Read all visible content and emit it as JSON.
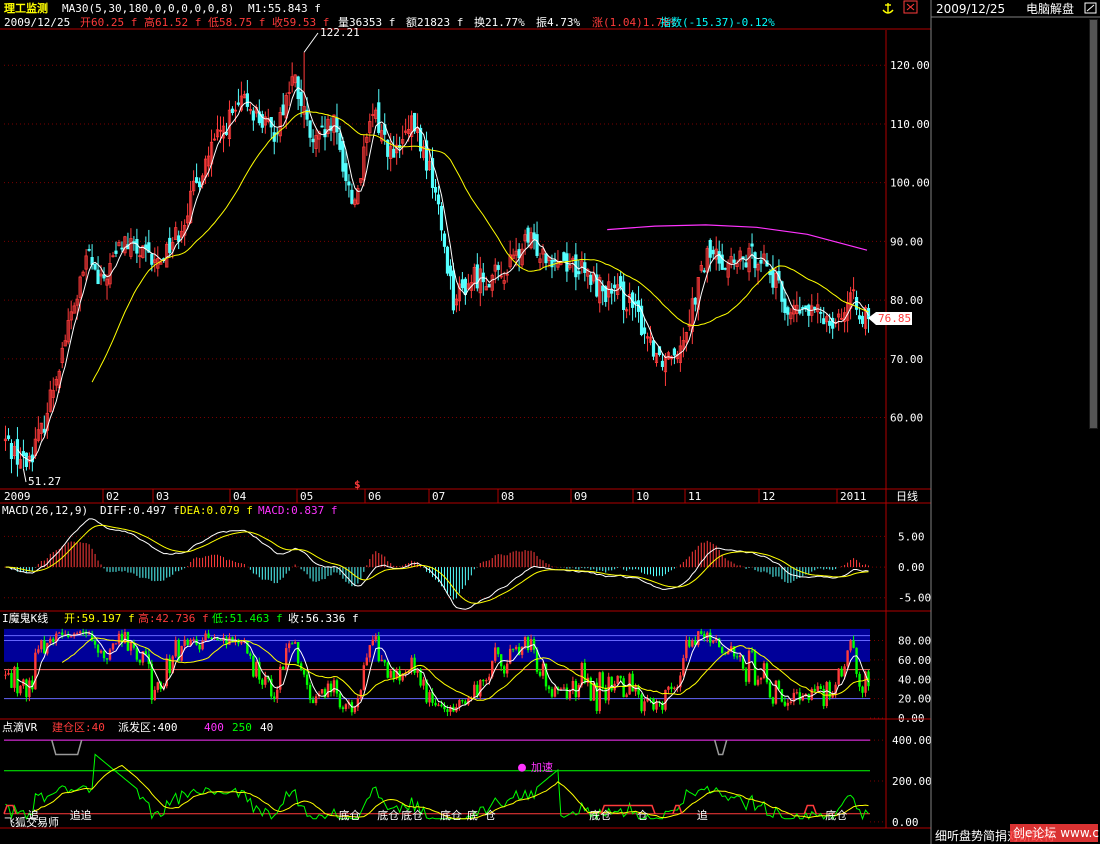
{
  "colors": {
    "bg": "#000000",
    "up": "#ff3b3b",
    "down": "#54ffff",
    "grid": "#7a0000",
    "border": "#b00000",
    "white": "#ffffff",
    "yellow": "#ffff00",
    "magenta": "#ff33ff",
    "cyan": "#00ffff",
    "green": "#00ff00",
    "blueband": "#000099",
    "gray": "#999999",
    "price_tag": "#ff3b3b"
  },
  "header": {
    "name": "理工监测",
    "ma_label": "MA30(5,30,180,0,0,0,0,0,8)",
    "m1": "M1:55.843 f",
    "date": "2009/12/25",
    "open": "开60.25 f",
    "high": "高61.52 f",
    "low": "低58.75 f",
    "close": "收59.53 f",
    "vol": "量36353 f",
    "amount": "额21823 f",
    "turnover": "换21.77%",
    "amplitude": "振4.73%",
    "change": "涨(1.04)1.78%",
    "index": "指数(-15.37)-0.12%"
  },
  "sidebar": {
    "date": "2009/12/25",
    "title": "电脑解盘"
  },
  "bottom_right_text": "细听盘势简捐对研跌将",
  "watermark": "创e论坛 www.cnci.com",
  "anchor_icon": "anchor-icon",
  "chart_data": [
    {
      "type": "candlestick",
      "panel": "price",
      "ylim": [
        48,
        126
      ],
      "yticks": [
        60,
        70,
        80,
        90,
        100,
        110,
        120
      ],
      "ytick_labels": [
        "60.00",
        "70.00",
        "80.00",
        "90.00",
        "100.00",
        "110.00",
        "120.00"
      ],
      "annotations": {
        "max_label": "122.21",
        "max_value": 122.21,
        "min_label": "51.27",
        "min_value": 51.27,
        "last_price": "76.85",
        "last_value": 76.85,
        "event_mark": "$"
      },
      "x_labels": [
        "2009",
        "02",
        "03",
        "04",
        "05",
        "06",
        "07",
        "08",
        "09",
        "10",
        "11",
        "12",
        "2011",
        "日线"
      ],
      "ma_label": "MA30(5,30,180,0,0,0,0,0,8)",
      "anchors": [
        [
          0,
          56
        ],
        [
          6,
          52
        ],
        [
          11,
          58
        ],
        [
          18,
          74
        ],
        [
          25,
          88
        ],
        [
          28,
          82
        ],
        [
          35,
          90
        ],
        [
          45,
          86
        ],
        [
          52,
          92
        ],
        [
          60,
          104
        ],
        [
          66,
          110
        ],
        [
          72,
          114
        ],
        [
          80,
          108
        ],
        [
          86,
          118
        ],
        [
          92,
          106
        ],
        [
          98,
          110
        ],
        [
          104,
          96
        ],
        [
          110,
          112
        ],
        [
          116,
          104
        ],
        [
          122,
          110
        ],
        [
          128,
          100
        ],
        [
          134,
          80
        ],
        [
          140,
          84
        ],
        [
          148,
          84
        ],
        [
          156,
          90
        ],
        [
          162,
          88
        ],
        [
          170,
          86
        ],
        [
          178,
          82
        ],
        [
          186,
          80
        ],
        [
          196,
          70
        ],
        [
          202,
          73
        ],
        [
          210,
          88
        ],
        [
          218,
          86
        ],
        [
          226,
          88
        ],
        [
          234,
          78
        ],
        [
          240,
          78
        ],
        [
          248,
          77
        ],
        [
          254,
          80
        ],
        [
          258,
          76
        ]
      ],
      "ma30_start": 20,
      "ma180": [
        [
          180,
          92
        ],
        [
          195,
          92.6
        ],
        [
          210,
          92.8
        ],
        [
          225,
          92.4
        ],
        [
          240,
          91.2
        ],
        [
          258,
          88.5
        ]
      ]
    },
    {
      "type": "bar",
      "panel": "macd",
      "title": "MACD(26,12,9)",
      "diff_label": "DIFF:0.497 f",
      "dea_label": "DEA:0.079 f",
      "macd_label": "MACD:0.837 f",
      "ylim": [
        -7,
        8
      ],
      "yticks": [
        -5,
        0,
        5
      ],
      "ytick_labels": [
        "-5.00",
        "0.00",
        "5.00"
      ]
    },
    {
      "type": "candlestick",
      "panel": "kline2",
      "title": "I魔鬼K线",
      "open_label": "开:59.197 f",
      "high_label": "高:42.736 f",
      "low_label": "低:51.463 f",
      "close_label": "收:56.336 f",
      "ylim": [
        0,
        95
      ],
      "yticks": [
        0,
        20,
        40,
        60,
        80
      ],
      "ytick_labels": [
        "0.00",
        "20.00",
        "40.00",
        "60.00",
        "80.00"
      ],
      "band": [
        58,
        92
      ],
      "hlines": [
        20,
        50,
        80,
        85
      ]
    },
    {
      "type": "line",
      "panel": "vr",
      "title": "点滴VR",
      "build_label": "建仓区:40",
      "sell_label": "派发区:400",
      "v1": "400",
      "v2": "250",
      "v3": "40",
      "ylim": [
        -20,
        430
      ],
      "yticks": [
        0,
        200,
        400
      ],
      "ytick_labels": [
        "0.00",
        "200.00",
        "400.00"
      ],
      "signal_label": "加速",
      "markers": [
        {
          "i": 8,
          "text": "追"
        },
        {
          "i": 22,
          "text": "追追"
        },
        {
          "i": 112,
          "text": "底仓"
        },
        {
          "i": 125,
          "text": "底仓"
        },
        {
          "i": 133,
          "text": "底仓"
        },
        {
          "i": 146,
          "text": "底仓"
        },
        {
          "i": 155,
          "text": "底"
        },
        {
          "i": 161,
          "text": "仓"
        },
        {
          "i": 196,
          "text": "底仓"
        },
        {
          "i": 212,
          "text": "仓"
        },
        {
          "i": 232,
          "text": "追"
        },
        {
          "i": 275,
          "text": "底仓"
        }
      ],
      "footer_label": "飞狐交易师"
    }
  ]
}
